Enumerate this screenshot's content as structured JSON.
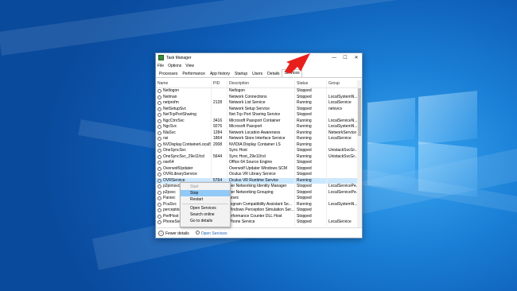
{
  "window": {
    "title": "Task Manager",
    "minimize_glyph": "—",
    "maximize_glyph": "☐",
    "close_glyph": "✕"
  },
  "menu": [
    "File",
    "Options",
    "View"
  ],
  "tabs": [
    "Processes",
    "Performance",
    "App history",
    "Startup",
    "Users",
    "Details",
    "Services"
  ],
  "active_tab": "Services",
  "columns": [
    "Name",
    "PID",
    "Description",
    "Status",
    "Group"
  ],
  "rows": [
    {
      "name": "Netlogon",
      "pid": "",
      "desc": "Netlogon",
      "status": "Stopped",
      "group": ""
    },
    {
      "name": "Netman",
      "pid": "",
      "desc": "Network Connections",
      "status": "Stopped",
      "group": "LocalSystemN..."
    },
    {
      "name": "netprofm",
      "pid": "2128",
      "desc": "Network List Service",
      "status": "Running",
      "group": "LocalService"
    },
    {
      "name": "NetSetupSvc",
      "pid": "",
      "desc": "Network Setup Service",
      "status": "Stopped",
      "group": "netsvcs"
    },
    {
      "name": "NetTcpPortSharing",
      "pid": "",
      "desc": "Net.Tcp Port Sharing Service",
      "status": "Stopped",
      "group": ""
    },
    {
      "name": "NgcCtnrSvc",
      "pid": "3416",
      "desc": "Microsoft Passport Container",
      "status": "Running",
      "group": "LocalServiceN..."
    },
    {
      "name": "NgcSvc",
      "pid": "9276",
      "desc": "Microsoft Passport",
      "status": "Running",
      "group": "LocalSystemN..."
    },
    {
      "name": "NlaSvc",
      "pid": "1284",
      "desc": "Network Location Awareness",
      "status": "Running",
      "group": "NetworkService"
    },
    {
      "name": "nsi",
      "pid": "1864",
      "desc": "Network Store Interface Service",
      "status": "Running",
      "group": "LocalService"
    },
    {
      "name": "NVDisplay.ContainerLocalS...",
      "pid": "2008",
      "desc": "NVIDIA Display Container LS",
      "status": "Running",
      "group": ""
    },
    {
      "name": "OneSyncSvc",
      "pid": "",
      "desc": "Sync Host",
      "status": "Stopped",
      "group": "UnistackSvcGr..."
    },
    {
      "name": "OneSyncSvc_29e11fcd",
      "pid": "5644",
      "desc": "Sync Host_29e11fcd",
      "status": "Running",
      "group": "UnistackSvcGr..."
    },
    {
      "name": "ose64",
      "pid": "",
      "desc": "Office 64 Source Engine",
      "status": "Stopped",
      "group": ""
    },
    {
      "name": "OverwolfUpdater",
      "pid": "",
      "desc": "Overwolf Updater Windows SCM",
      "status": "Stopped",
      "group": ""
    },
    {
      "name": "OVRLibraryService",
      "pid": "",
      "desc": "Oculus VR Library Service",
      "status": "Stopped",
      "group": ""
    },
    {
      "name": "OVRService",
      "pid": "5764",
      "desc": "Oculus VR Runtime Service",
      "status": "Running",
      "group": ""
    },
    {
      "name": "p2pimsvc",
      "pid": "",
      "desc": "eer Networking Identity Manager",
      "status": "Stopped",
      "group": "LocalServicePe..."
    },
    {
      "name": "p2psvc",
      "pid": "",
      "desc": "eer Networking Grouping",
      "status": "Stopped",
      "group": "LocalServicePe..."
    },
    {
      "name": "Parsec",
      "pid": "",
      "desc": "arsec",
      "status": "Stopped",
      "group": ""
    },
    {
      "name": "PcaSvc",
      "pid": "",
      "desc": "rogram Compatibility Assistant Se...",
      "status": "Running",
      "group": "LocalSystemN..."
    },
    {
      "name": "perception",
      "pid": "",
      "desc": "Vindows Perception Simulation Ser...",
      "status": "Stopped",
      "group": ""
    },
    {
      "name": "PerfHost",
      "pid": "",
      "desc": "erformance Counter DLL Host",
      "status": "Stopped",
      "group": ""
    },
    {
      "name": "PhoneSvc",
      "pid": "",
      "desc": "Phone Service",
      "status": "Stopped",
      "group": "LocalService"
    }
  ],
  "selected_row": "OVRService",
  "context_menu": {
    "items": [
      "Start",
      "Stop",
      "Restart",
      "Open Services",
      "Search online",
      "Go to details"
    ],
    "disabled": "Start",
    "highlighted": "Stop"
  },
  "footer": {
    "fewer_details": "Fewer details",
    "open_services": "Open Services"
  },
  "colors": {
    "arrow": "#e8201c",
    "selection": "#cce8ff",
    "link": "#1a5fb4"
  }
}
